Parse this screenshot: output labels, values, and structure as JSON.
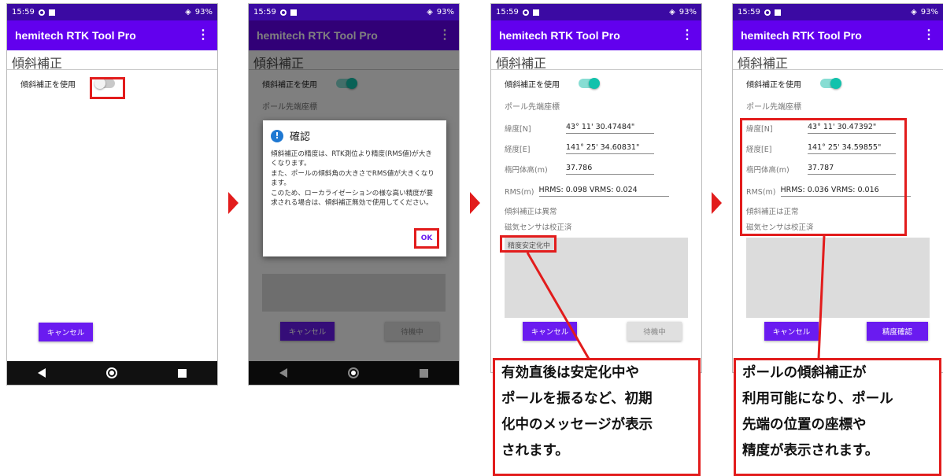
{
  "status_bar": {
    "time": "15:59",
    "battery": "93%"
  },
  "app": {
    "title": "hemitech RTK Tool Pro",
    "menu_icon": "more-vert-icon"
  },
  "page_title": "傾斜補正",
  "toggle_label": "傾斜補正を使用",
  "screen1": {
    "toggle_on": false,
    "cancel": "キャンセル"
  },
  "screen2": {
    "section": "ポール先端座標",
    "dialog_title": "確認",
    "dialog_body": "傾斜補正の精度は、RTK測位より精度(RMS値)が大きくなります。\nまた、ポールの傾斜角の大きさでRMS値が大きくなります。\nこのため、ローカライゼーションの様な高い精度が要求される場合は、傾斜補正無効で使用してください。",
    "ok": "OK",
    "cancel": "キャンセル",
    "wait": "待機中"
  },
  "screen3": {
    "section": "ポール先端座標",
    "lat_label": "緯度[N]",
    "lat": "43° 11' 30.47484\"",
    "lon_label": "経度[E]",
    "lon": "141° 25' 34.60831\"",
    "h_label": "楕円体高(m)",
    "h": "37.786",
    "rms_label": "RMS(m)",
    "rms": "HRMS: 0.098  VRMS: 0.024",
    "status1": "傾斜補正は異常",
    "status2": "磁気センサは校正済",
    "message": "精度安定化中",
    "cancel": "キャンセル",
    "wait": "待機中"
  },
  "screen4": {
    "section": "ポール先端座標",
    "lat_label": "緯度[N]",
    "lat": "43° 11' 30.47392\"",
    "lon_label": "経度[E]",
    "lon": "141° 25' 34.59855\"",
    "h_label": "楕円体高(m)",
    "h": "37.787",
    "rms_label": "RMS(m)",
    "rms": "HRMS: 0.036  VRMS: 0.016",
    "status1": "傾斜補正は正常",
    "status2": "磁気センサは校正済",
    "cancel": "キャンセル",
    "confirm": "精度確認"
  },
  "callouts": {
    "left_lines": [
      "有効直後は安定化中や",
      "ポールを振るなど、初期",
      "化中のメッセージが表示",
      "されます。"
    ],
    "right_lines": [
      "ポールの傾斜補正が",
      "利用可能になり、ポール",
      "先端の位置の座標や",
      "精度が表示されます。"
    ]
  },
  "colors": {
    "accent": "#6200ee",
    "status_bar": "#3b0aa3",
    "toggle_on": "#12c2ac",
    "highlight": "#e21c1c"
  }
}
